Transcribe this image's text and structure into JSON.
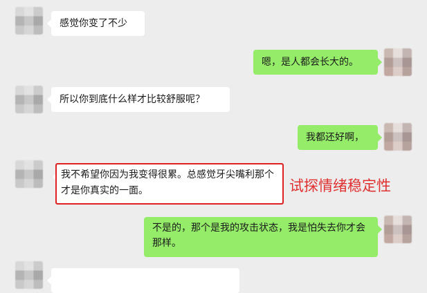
{
  "messages": [
    {
      "side": "left",
      "text": "感觉你变了不少"
    },
    {
      "side": "right",
      "text": "嗯，是人都会长大的。"
    },
    {
      "side": "left",
      "text": "所以你到底什么样才比较舒服呢？"
    },
    {
      "side": "right",
      "text": "我都还好啊，"
    },
    {
      "side": "left",
      "text": "我不希望你因为我变得很累。总感觉牙尖嘴利那个才是你真实的一面。"
    },
    {
      "side": "right",
      "text": "不是的，那个是我的攻击状态，我是怕失去你才会那样。"
    },
    {
      "side": "left",
      "text": ""
    }
  ],
  "annotation": {
    "text": "试探情绪稳定性",
    "color": "#e03030"
  },
  "colors": {
    "background": "#ededed",
    "left_bubble": "#ffffff",
    "right_bubble": "#95ec69",
    "highlight_border": "#e02020"
  }
}
